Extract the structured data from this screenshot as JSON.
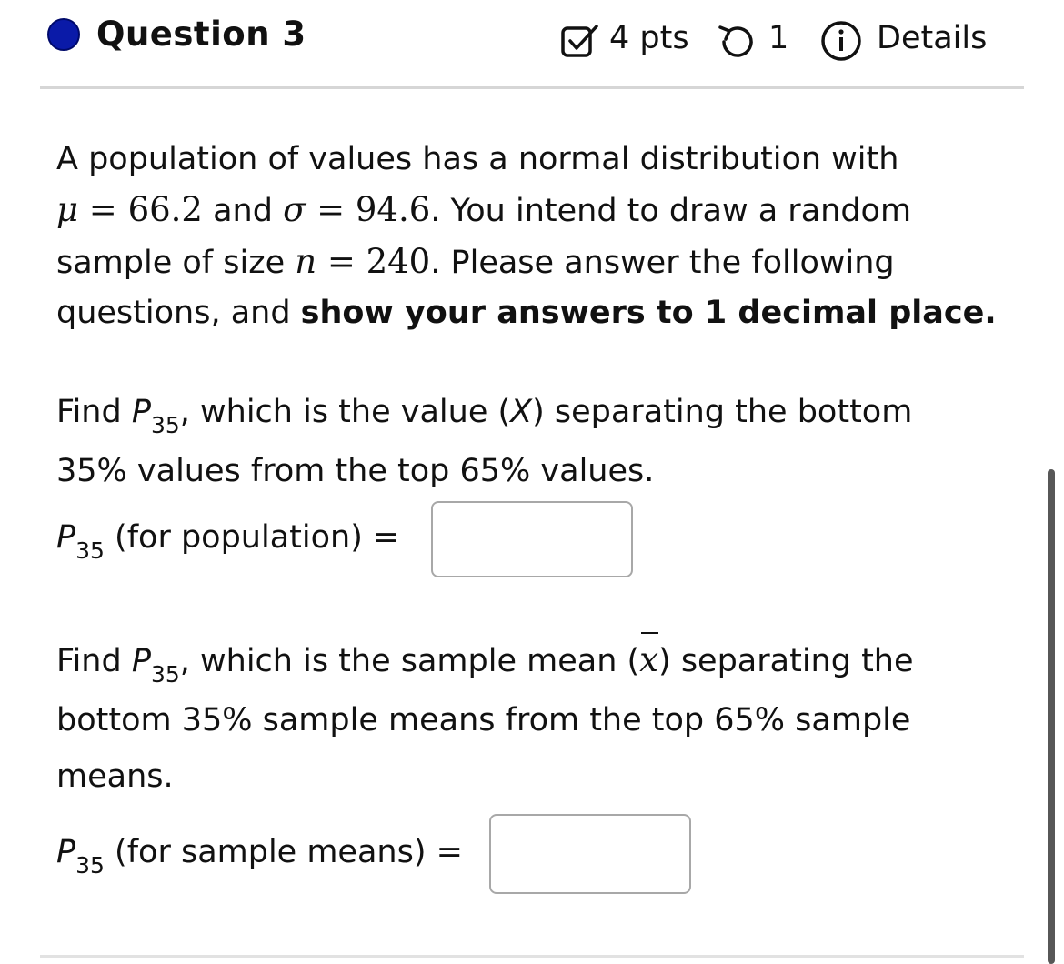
{
  "question": {
    "title": "Question 3",
    "points": "4 pts",
    "attempts": "1",
    "details_label": "Details",
    "status_color": "#0a1aa8",
    "icons": [
      "status-dot",
      "checkbox-check-icon",
      "retry-icon",
      "info-icon"
    ]
  },
  "intro": {
    "line1": "A population of values has a normal distribution with",
    "mu_symbol": "μ",
    "eq1": " = 66.2",
    "and_text": " and ",
    "sigma_symbol": "σ",
    "eq2": " = 94.6",
    "after_sigma": ". You intend to draw a random",
    "sample_text": "sample of size ",
    "n_symbol": "n",
    "eq3": " = 240",
    "after_n": ". Please answer the following",
    "questions_text": "questions, and ",
    "bold_text": "show your answers to 1 decimal place."
  },
  "part1": {
    "find": "Find ",
    "p": "P",
    "sub": "35",
    "desc_a": ", which is the value (",
    "x": "X",
    "desc_b": ") separating the bottom",
    "line2": "35% values from the top 65% values.",
    "label": " (for population) =",
    "answer_value": ""
  },
  "part2": {
    "find": "Find ",
    "p": "P",
    "sub": "35",
    "desc_a": ", which is the sample mean (",
    "xbar": "x",
    "desc_b": ") separating the",
    "line2": "bottom 35% sample means from the top 65% sample",
    "line3": "means.",
    "label": " (for sample means) =",
    "answer_value": ""
  }
}
